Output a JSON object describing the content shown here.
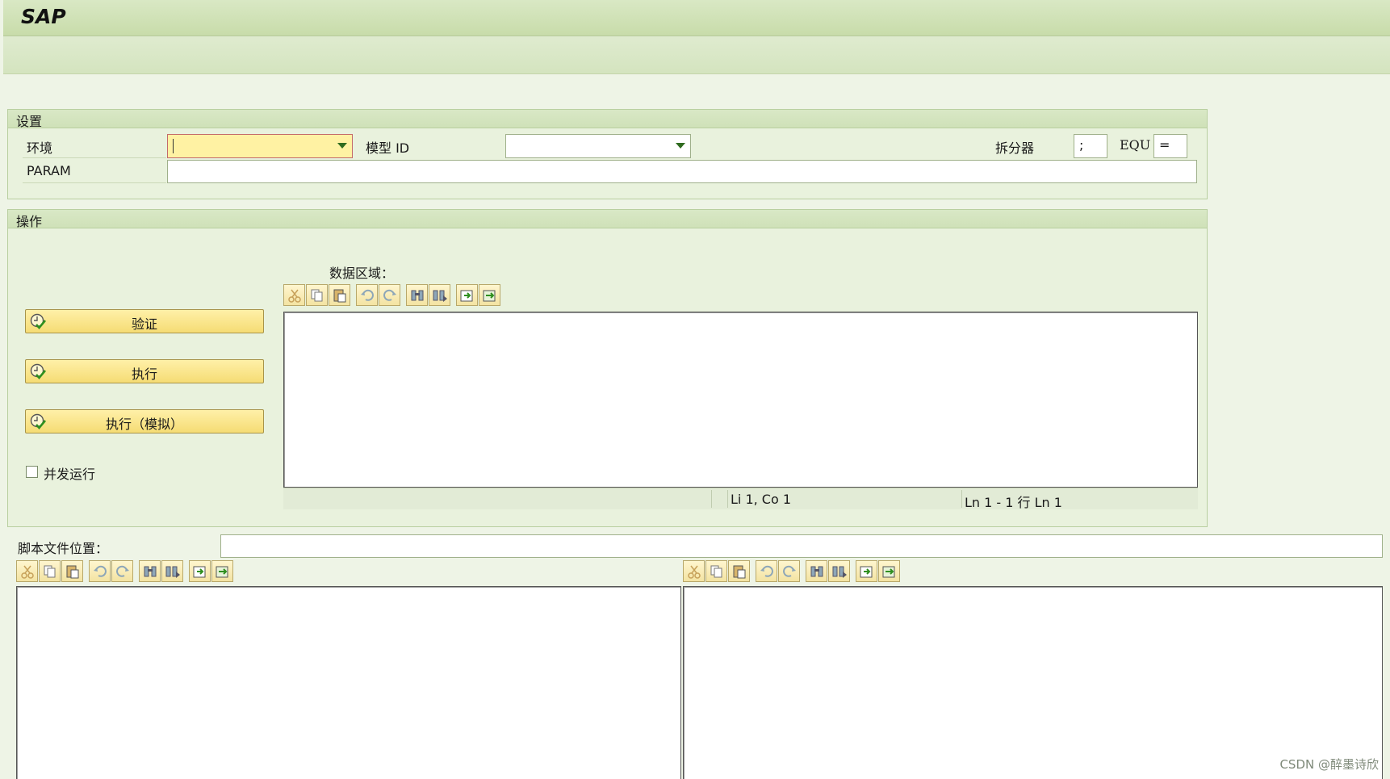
{
  "app": {
    "title": "SAP"
  },
  "settings": {
    "title": "设置",
    "env_label": "环境",
    "env_value": "",
    "model_label": "模型 ID",
    "model_value": "",
    "splitter_label": "拆分器",
    "splitter_value": ";",
    "equ_label": "EQU",
    "equ_value": "=",
    "param_label": "PARAM",
    "param_value": ""
  },
  "operations": {
    "title": "操作",
    "buttons": [
      "验证",
      "执行",
      "执行（模拟）"
    ],
    "parallel_label": "并发运行",
    "parallel_checked": false,
    "data_area_label": "数据区域：",
    "status_position": "Li 1, Co 1",
    "status_lines": "Ln 1 - 1 行 Ln 1"
  },
  "script": {
    "file_location_label": "脚本文件位置：",
    "file_location_value": ""
  },
  "editor_tools": [
    "cut-icon",
    "copy-icon",
    "paste-icon",
    "undo-icon",
    "redo-icon",
    "find-icon",
    "find-next-icon",
    "upload-icon",
    "download-icon"
  ],
  "watermark": "CSDN @醉墨诗欣",
  "colors": {
    "button_fill": "#f5dc74",
    "group_fill": "#e9f2dd",
    "required_field": "#fff2a3"
  }
}
